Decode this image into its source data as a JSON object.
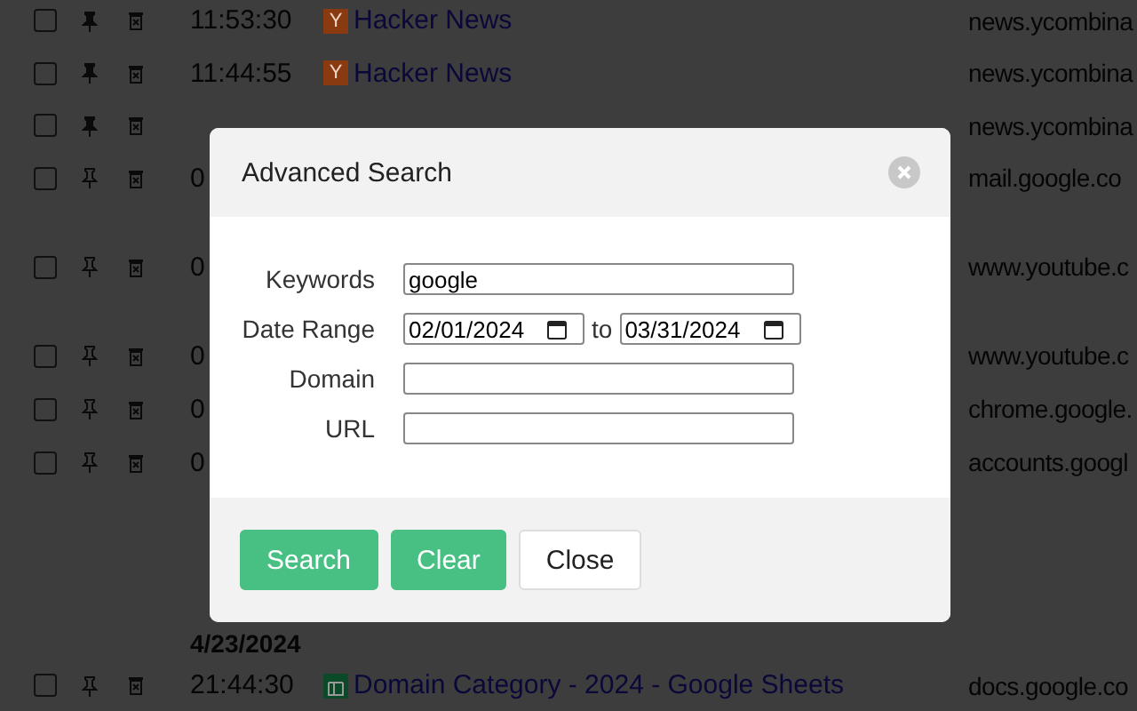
{
  "history": [
    {
      "kind": "row",
      "checked": false,
      "pinned": true,
      "time": "11:53:30",
      "favicon": {
        "kind": "letter",
        "text": "Y"
      },
      "title": "Hacker News",
      "domain": "news.ycombina"
    },
    {
      "kind": "row",
      "checked": false,
      "pinned": true,
      "time": "11:44:55",
      "favicon": {
        "kind": "letter",
        "text": "Y"
      },
      "title": "Hacker News",
      "domain": "news.ycombina"
    },
    {
      "kind": "row",
      "checked": false,
      "pinned": true,
      "domain": "news.ycombina"
    },
    {
      "kind": "row",
      "checked": false,
      "pinned": false,
      "time": "0",
      "domain": "mail.google.co"
    },
    {
      "kind": "row",
      "checked": false,
      "pinned": false,
      "time": "0",
      "domain": "www.youtube.c"
    },
    {
      "kind": "row",
      "checked": false,
      "pinned": false,
      "time": "0",
      "domain": "www.youtube.c"
    },
    {
      "kind": "row",
      "checked": false,
      "pinned": false,
      "time": "0",
      "domain": "chrome.google."
    },
    {
      "kind": "row",
      "checked": false,
      "pinned": false,
      "time": "0",
      "domain": "accounts.googl"
    },
    {
      "kind": "spacer"
    },
    {
      "kind": "date",
      "label": "4/23/2024"
    },
    {
      "kind": "row",
      "checked": false,
      "pinned": false,
      "time": "21:44:30",
      "favicon": {
        "kind": "sheet"
      },
      "title": "Domain Category - 2024 - Google Sheets",
      "domain": "docs.google.co"
    }
  ],
  "dialog": {
    "title": "Advanced Search",
    "fields": [
      {
        "kind": "text",
        "label": "Keywords",
        "value": "google"
      },
      {
        "kind": "range",
        "label": "Date Range",
        "from": "02/01/2024",
        "separator": "to",
        "to": "03/31/2024"
      },
      {
        "kind": "text",
        "label": "Domain"
      },
      {
        "kind": "text",
        "label": "URL"
      }
    ],
    "buttons": [
      {
        "label": "Search",
        "primary": true
      },
      {
        "label": "Clear",
        "primary": true
      },
      {
        "label": "Close",
        "primary": false
      }
    ]
  }
}
